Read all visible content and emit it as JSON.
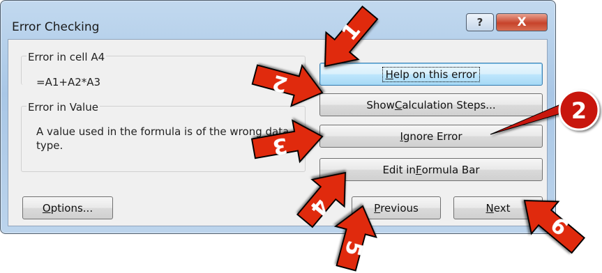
{
  "window": {
    "title": "Error Checking"
  },
  "titlebar": {
    "help_glyph": "?",
    "close_glyph": "X"
  },
  "error_cell": {
    "label": "Error in cell A4",
    "formula": "=A1+A2*A3"
  },
  "error_type": {
    "label": "Error in Value",
    "description": "A value used in the formula is of the wrong data type."
  },
  "buttons": {
    "help": {
      "pre": "",
      "key": "H",
      "post": "elp on this error"
    },
    "steps": {
      "pre": "Show ",
      "key": "C",
      "post": "alculation Steps..."
    },
    "ignore": {
      "pre": "",
      "key": "I",
      "post": "gnore Error"
    },
    "edit": {
      "pre": "Edit in ",
      "key": "F",
      "post": "ormula Bar"
    },
    "options": {
      "pre": "",
      "key": "O",
      "post": "ptions..."
    },
    "previous": {
      "pre": "",
      "key": "P",
      "post": "revious"
    },
    "next": {
      "pre": "",
      "key": "N",
      "post": "ext"
    }
  },
  "annotations": {
    "arrow_color": "#e02b10",
    "circle_color": "#c8140c",
    "arrow_labels": [
      "1",
      "2",
      "3",
      "4",
      "5",
      "6"
    ],
    "circle_label": "2"
  }
}
